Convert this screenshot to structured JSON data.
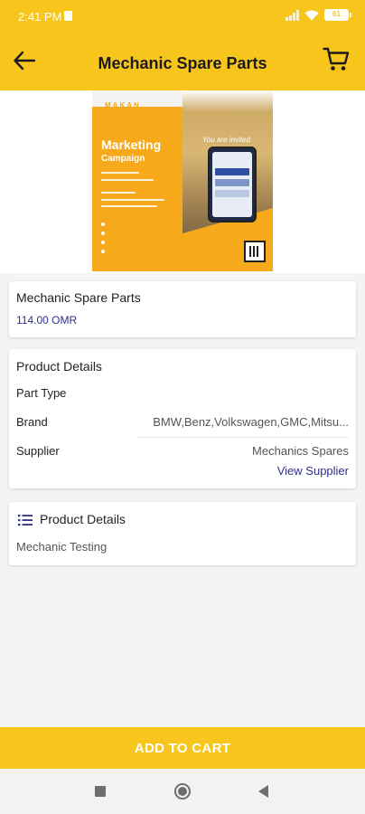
{
  "status_bar": {
    "time": "2:41 PM",
    "battery": "61",
    "icons": [
      "trash-icon",
      "signal-icon",
      "wifi-icon",
      "battery-icon"
    ]
  },
  "app_bar": {
    "title": "Mechanic Spare Parts",
    "back_icon": "arrow-left-icon",
    "cart_icon": "cart-icon"
  },
  "banner": {
    "brand": "MAKAN",
    "headline": "Marketing",
    "subheadline": "Campaign",
    "tagline": "You are invited"
  },
  "product": {
    "name": "Mechanic Spare Parts",
    "price": "114.00 OMR"
  },
  "details": {
    "title": "Product Details",
    "rows": [
      {
        "label": "Part Type",
        "value": ""
      },
      {
        "label": "Brand",
        "value": "BMW,Benz,Volkswagen,GMC,Mitsu..."
      },
      {
        "label": "Supplier",
        "value": "Mechanics Spares"
      }
    ],
    "view_supplier_label": "View Supplier"
  },
  "description": {
    "title": "Product Details",
    "icon": "list-icon",
    "text": "Mechanic Testing"
  },
  "cta": {
    "add_to_cart_label": "ADD TO CART"
  },
  "colors": {
    "primary": "#f7c51b",
    "link": "#2d2f8c"
  }
}
